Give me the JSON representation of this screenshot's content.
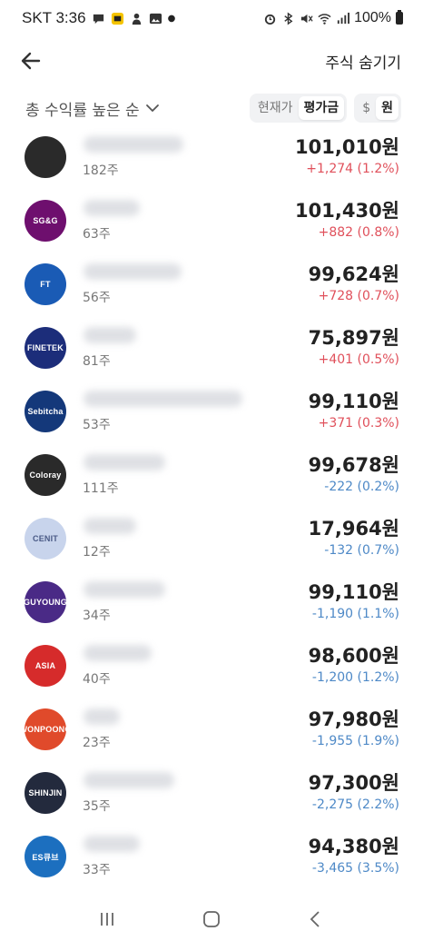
{
  "status": {
    "carrier_time": "SKT 3:36",
    "battery_text": "100%"
  },
  "header": {
    "hide_label": "주식 숨기기"
  },
  "controls": {
    "sort_label": "총 수익률 높은 순",
    "price_toggle": [
      "현재가",
      "평가금"
    ],
    "price_toggle_active": "평가금",
    "currency_toggle": [
      "$",
      "원"
    ],
    "currency_toggle_active": "원"
  },
  "stocks": [
    {
      "logo_text": "",
      "logo_color": "#2a2a2a",
      "shares": "182주",
      "value": "101,010원",
      "change": "+1,274 (1.2%)",
      "direction": "up"
    },
    {
      "logo_text": "SG&G",
      "logo_color": "#6e0f6e",
      "shares": "63주",
      "value": "101,430원",
      "change": "+882 (0.8%)",
      "direction": "up"
    },
    {
      "logo_text": "FT",
      "logo_color": "#1a5bb5",
      "shares": "56주",
      "value": "99,624원",
      "change": "+728 (0.7%)",
      "direction": "up"
    },
    {
      "logo_text": "FINETEK",
      "logo_color": "#1c2d7a",
      "shares": "81주",
      "value": "75,897원",
      "change": "+401 (0.5%)",
      "direction": "up"
    },
    {
      "logo_text": "Sebitcha",
      "logo_color": "#14387a",
      "shares": "53주",
      "value": "99,110원",
      "change": "+371 (0.3%)",
      "direction": "up"
    },
    {
      "logo_text": "Coloray",
      "logo_color": "#2a2a2a",
      "shares": "111주",
      "value": "99,678원",
      "change": "-222 (0.2%)",
      "direction": "down"
    },
    {
      "logo_text": "CENIT",
      "logo_color": "#c8d4ec",
      "shares": "12주",
      "value": "17,964원",
      "change": "-132 (0.7%)",
      "direction": "down"
    },
    {
      "logo_text": "GUYOUNG",
      "logo_color": "#4a2a86",
      "shares": "34주",
      "value": "99,110원",
      "change": "-1,190 (1.1%)",
      "direction": "down"
    },
    {
      "logo_text": "ASIA",
      "logo_color": "#d62b2b",
      "shares": "40주",
      "value": "98,600원",
      "change": "-1,200 (1.2%)",
      "direction": "down"
    },
    {
      "logo_text": "WONPOONG",
      "logo_color": "#e04a2b",
      "shares": "23주",
      "value": "97,980원",
      "change": "-1,955 (1.9%)",
      "direction": "down"
    },
    {
      "logo_text": "SHINJIN",
      "logo_color": "#232a3d",
      "shares": "35주",
      "value": "97,300원",
      "change": "-2,275 (2.2%)",
      "direction": "down"
    },
    {
      "logo_text": "ES큐브",
      "logo_color": "#1c6fbf",
      "shares": "33주",
      "value": "94,380원",
      "change": "-3,465 (3.5%)",
      "direction": "down"
    }
  ],
  "colors": {
    "up": "#e0505b",
    "down": "#4e89c7"
  },
  "icons": {
    "back": "arrow-left-icon",
    "sort": "chevron-down-icon",
    "nav": [
      "recent-apps-icon",
      "home-icon",
      "back-nav-icon"
    ]
  }
}
